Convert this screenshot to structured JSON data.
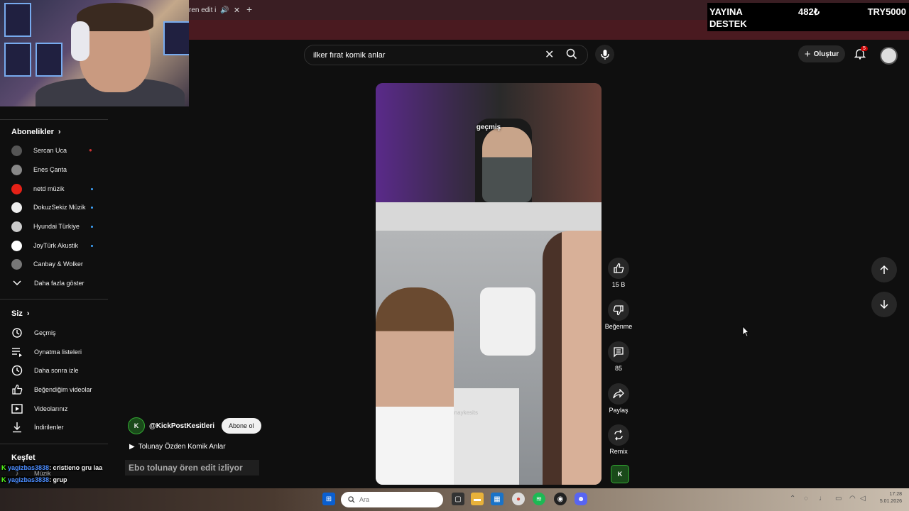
{
  "browser": {
    "tab_title": "ren edit i",
    "new_tab": "+"
  },
  "donation": {
    "line1": "YAYINA",
    "line2": "DESTEK",
    "amount": "482₺",
    "goal": "TRY5000"
  },
  "search": {
    "value": "ilker fırat komik anlar"
  },
  "header": {
    "create_label": "Oluştur",
    "notification_count": "5"
  },
  "sidebar": {
    "subscriptions_heading": "Abonelikler",
    "subscriptions": [
      {
        "label": "Sercan Uca",
        "live": true,
        "color": "#555"
      },
      {
        "label": "Enes Çanta",
        "color": "#888"
      },
      {
        "label": "netd müzik",
        "dot": true,
        "color": "#e62117"
      },
      {
        "label": "DokuzSekiz Müzik",
        "dot": true,
        "color": "#eee"
      },
      {
        "label": "Hyundai Türkiye",
        "dot": true,
        "color": "#ccc"
      },
      {
        "label": "JoyTürk Akustik",
        "dot": true,
        "color": "#fff"
      },
      {
        "label": "Canbay & Wolker",
        "color": "#777"
      }
    ],
    "show_more": "Daha fazla göster",
    "you_heading": "Siz",
    "you_items": [
      {
        "label": "Geçmiş",
        "icon": "history-icon"
      },
      {
        "label": "Oynatma listeleri",
        "icon": "playlist-icon"
      },
      {
        "label": "Daha sonra izle",
        "icon": "clock-icon"
      },
      {
        "label": "Beğendiğim videolar",
        "icon": "thumbs-up-icon"
      },
      {
        "label": "Videolarınız",
        "icon": "video-icon"
      },
      {
        "label": "İndirilenler",
        "icon": "download-icon"
      }
    ],
    "explore_heading": "Keşfet",
    "music_label": "Müzik"
  },
  "video": {
    "caption": "geçmiş",
    "fridge_label": "Tolunaykesits"
  },
  "actions": {
    "like_count": "15 B",
    "dislike_label": "Beğenme",
    "comment_count": "85",
    "share_label": "Paylaş",
    "remix_label": "Remix"
  },
  "channel": {
    "handle": "@KickPostKesitleri",
    "subscribe_label": "Abone ol",
    "playlist_title": "Tolunay Özden Komik Anlar"
  },
  "stream_title": "Ebo tolunay ören edit izliyor",
  "chat": [
    {
      "user": "yagizbas3838",
      "message": ": cristieno gru laa"
    },
    {
      "user": "yagizbas3838",
      "message": ": grup"
    }
  ],
  "taskbar": {
    "search_placeholder": "Ara",
    "time": "17:28",
    "date": "5.01.2026"
  }
}
